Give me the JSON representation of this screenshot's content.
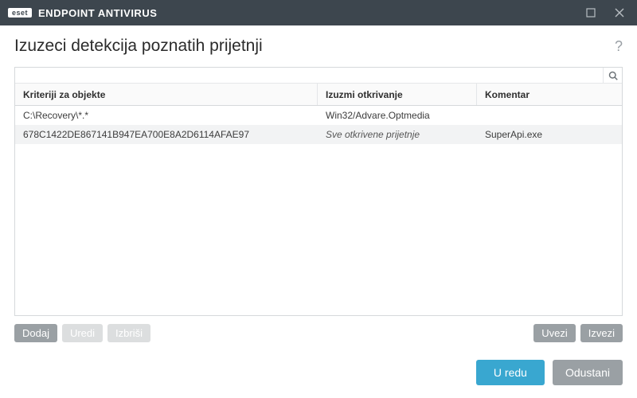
{
  "titlebar": {
    "logo": "eset",
    "product": "ENDPOINT ANTIVIRUS"
  },
  "page": {
    "title": "Izuzeci detekcija poznatih prijetnji"
  },
  "table": {
    "headers": {
      "criteria": "Kriteriji za objekte",
      "exclude": "Izuzmi otkrivanje",
      "comment": "Komentar"
    },
    "rows": [
      {
        "criteria": "C:\\Recovery\\*.*",
        "exclude": "Win32/Advare.Optmedia",
        "exclude_italic": false,
        "comment": ""
      },
      {
        "criteria": "678C1422DE867141B947EA700E8A2D6114AFAE97",
        "exclude": "Sve otkrivene prijetnje",
        "exclude_italic": true,
        "comment": "SuperApi.exe"
      }
    ]
  },
  "toolbar": {
    "add": "Dodaj",
    "edit": "Uredi",
    "delete": "Izbriši",
    "import": "Uvezi",
    "export": "Izvezi"
  },
  "footer": {
    "ok": "U redu",
    "cancel": "Odustani"
  }
}
